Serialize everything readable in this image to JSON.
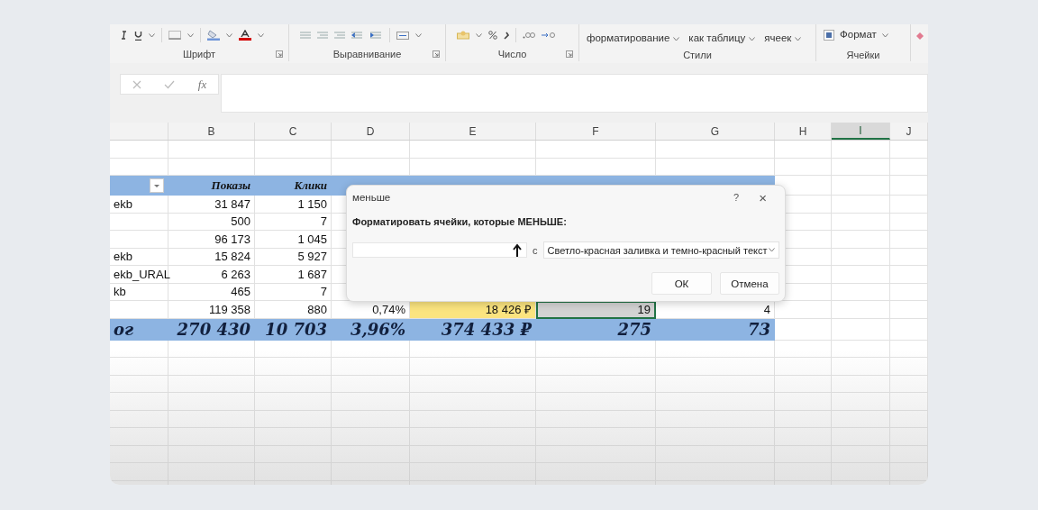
{
  "ribbon": {
    "groups": [
      {
        "label": "Шрифт",
        "kind": "font-tools"
      },
      {
        "label": "Выравнивание",
        "kind": "alignment-tools"
      },
      {
        "label": "Число",
        "kind": "number-tools"
      },
      {
        "label": "Стили",
        "kind": "buttons",
        "buttons": [
          {
            "kind": "text",
            "label": "форматирование"
          },
          {
            "kind": "text",
            "label": "как таблицу"
          },
          {
            "kind": "text",
            "label": "ячеек"
          }
        ]
      },
      {
        "label": "Ячейки",
        "kind": "buttons",
        "buttons": [
          {
            "kind": "format",
            "label": "Формат"
          }
        ]
      }
    ]
  },
  "formula_bar": {
    "fx": "fx"
  },
  "sheet": {
    "columns": [
      {
        "selected": false
      },
      {
        "letter": "B",
        "selected": false
      },
      {
        "letter": "C",
        "selected": false
      },
      {
        "letter": "D",
        "selected": false
      },
      {
        "letter": "E",
        "selected": false
      },
      {
        "letter": "F",
        "selected": false
      },
      {
        "letter": "G",
        "selected": false
      },
      {
        "letter": "H",
        "selected": false
      },
      {
        "letter": "I",
        "selected": true
      },
      {
        "letter": "J",
        "selected": false
      }
    ],
    "rows": [
      {
        "kind": "blank"
      },
      {
        "kind": "blank"
      },
      {
        "kind": "header",
        "cells": [
          {
            "kind": "filter"
          },
          {
            "kind": "title",
            "text": "Показы"
          },
          {
            "kind": "title",
            "text": "Клики"
          },
          null,
          null,
          null,
          null
        ]
      },
      {
        "kind": "data",
        "cells": [
          {
            "text": "ekb",
            "selected": false
          },
          {
            "text": "31 847",
            "selected": false
          },
          {
            "text": "1 150",
            "selected": false
          },
          null,
          null,
          null,
          null
        ]
      },
      {
        "kind": "data",
        "cells": [
          {
            "selected": false
          },
          {
            "text": "500",
            "selected": false
          },
          {
            "text": "7",
            "selected": false
          },
          null,
          null,
          null,
          null
        ]
      },
      {
        "kind": "data",
        "cells": [
          {
            "selected": false
          },
          {
            "text": "96 173",
            "selected": false
          },
          {
            "text": "1 045",
            "selected": false
          },
          null,
          null,
          null,
          null
        ]
      },
      {
        "kind": "data",
        "cells": [
          {
            "text": "ekb",
            "selected": false
          },
          {
            "text": "15 824",
            "selected": false
          },
          {
            "text": "5 927",
            "selected": false
          },
          null,
          null,
          null,
          null
        ]
      },
      {
        "kind": "data",
        "cells": [
          {
            "text": "ekb_URAL",
            "selected": false
          },
          {
            "text": "6 263",
            "selected": false
          },
          {
            "text": "1 687",
            "selected": false
          },
          null,
          null,
          null,
          null
        ]
      },
      {
        "kind": "data",
        "cells": [
          {
            "text": "kb",
            "selected": false
          },
          {
            "text": "465",
            "selected": false
          },
          {
            "text": "7",
            "selected": false
          },
          null,
          null,
          null,
          null
        ]
      },
      {
        "kind": "data",
        "cells": [
          {
            "selected": false
          },
          {
            "text": "119 358",
            "selected": false
          },
          {
            "text": "880",
            "selected": false
          },
          {
            "text": "0,74%",
            "selected": false
          },
          {
            "text": "18 426 ₽",
            "color": "#fbe47f",
            "selected": false
          },
          {
            "text": "19",
            "color": "#d3d3d3",
            "selected": true
          },
          {
            "text": "4",
            "selected": false
          }
        ]
      },
      {
        "kind": "total",
        "cells": [
          {
            "text": "ог"
          },
          {
            "text": "270 430"
          },
          {
            "text": "10 703"
          },
          {
            "text": "3,96%"
          },
          {
            "text": "374 433 ₽"
          },
          {
            "text": "275"
          },
          {
            "text": "73"
          }
        ]
      }
    ]
  },
  "dialog": {
    "title": "меньше",
    "help": "?",
    "close": "×",
    "prompt": "Форматировать ячейки, которые МЕНЬШЕ:",
    "connector": "с",
    "format": "Светло-красная заливка и темно-красный текст",
    "buttons": [
      "ОК",
      "Отмена"
    ]
  }
}
